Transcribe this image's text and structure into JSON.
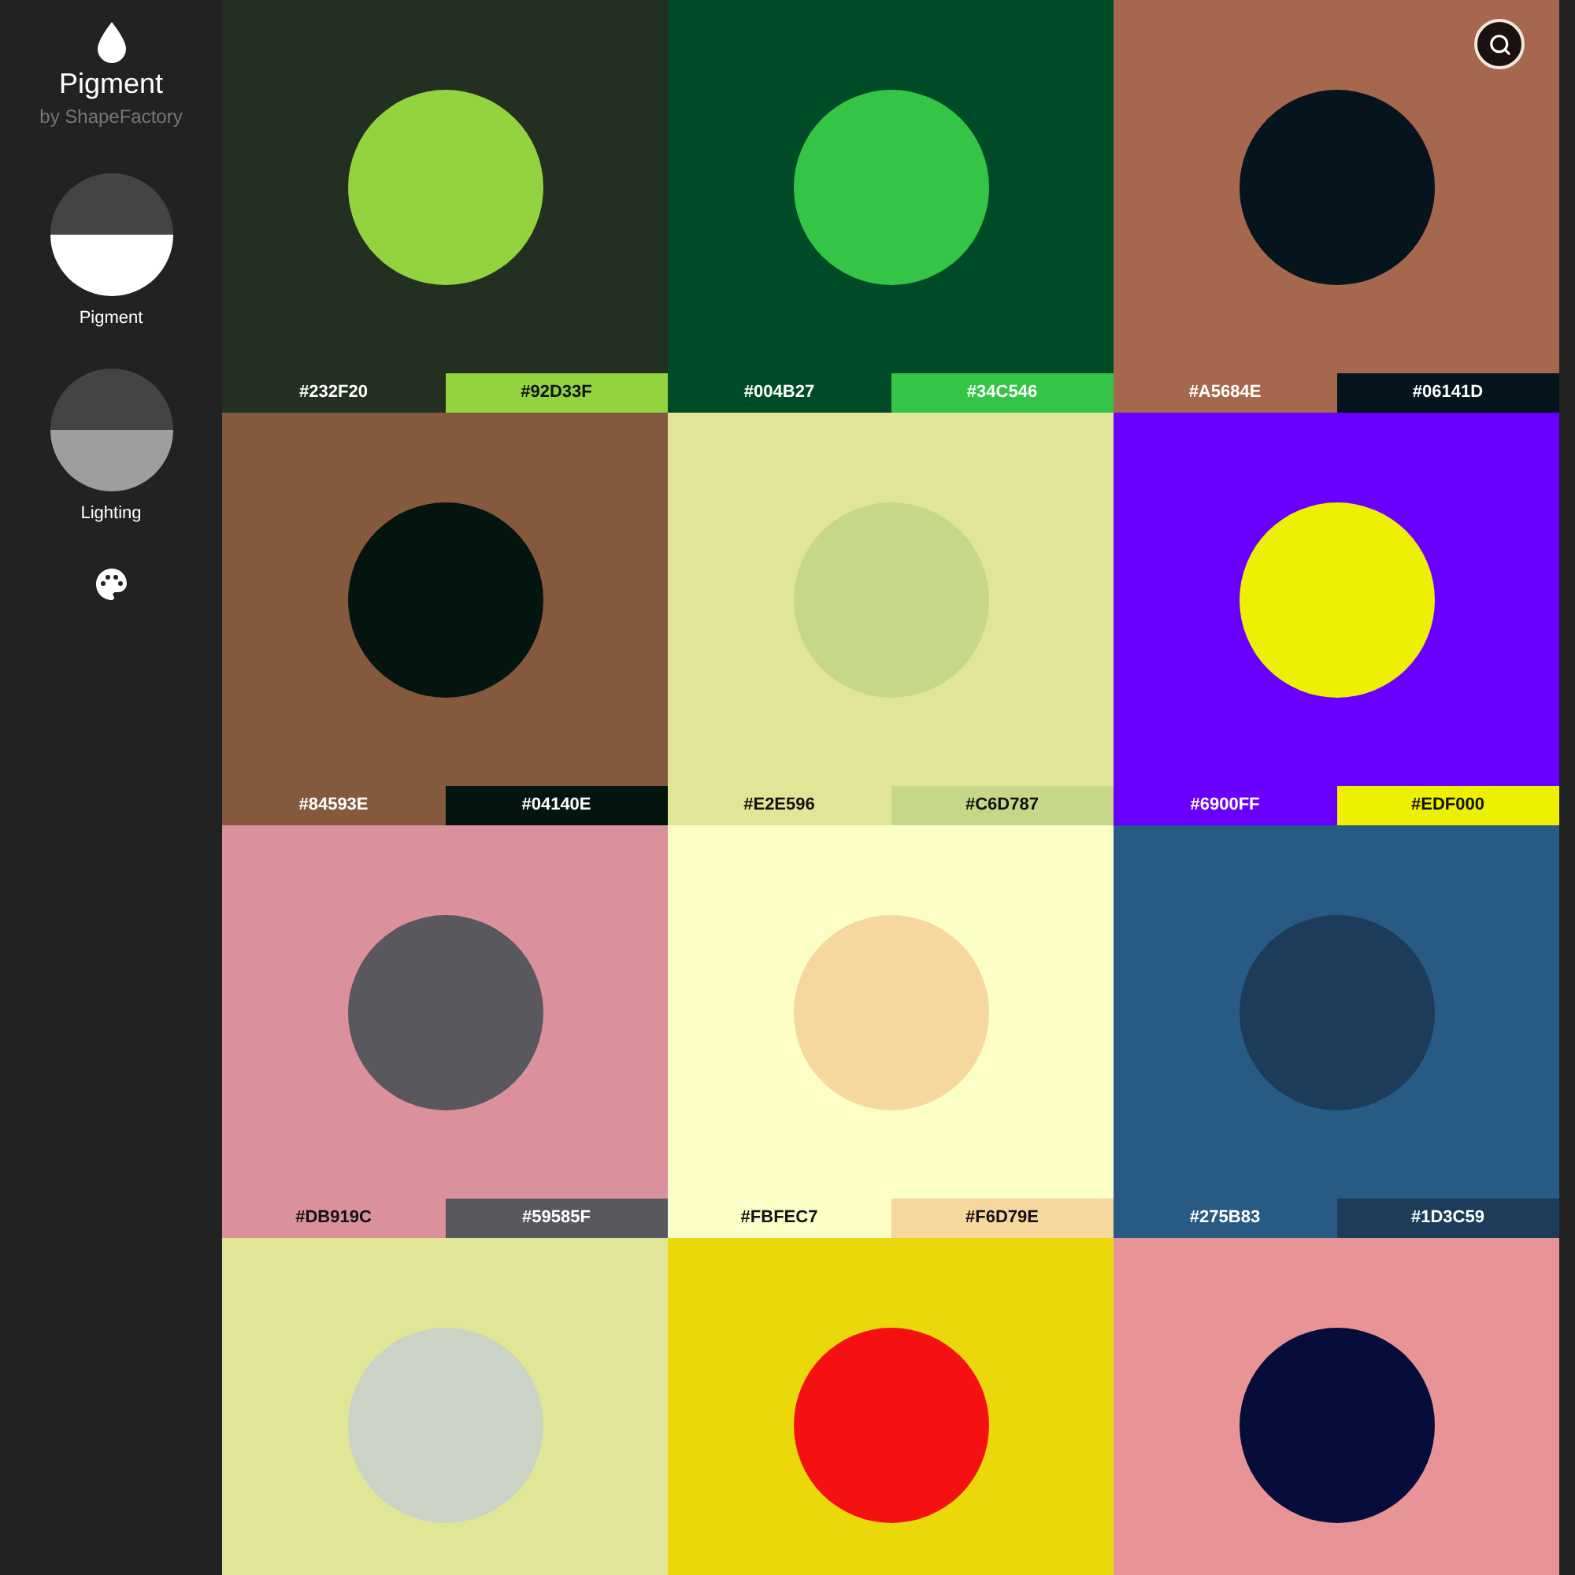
{
  "app": {
    "title": "Pigment",
    "subtitle": "by ShapeFactory"
  },
  "sidebar": {
    "items": [
      {
        "kind": "pigment",
        "label": "Pigment"
      },
      {
        "kind": "lighting",
        "label": "Lighting"
      },
      {
        "kind": "palette"
      }
    ]
  },
  "palettes": [
    {
      "background": {
        "color": "#232f20",
        "label": "#232F20"
      },
      "shape": {
        "color": "#92d33f",
        "label": "#92D33F"
      }
    },
    {
      "background": {
        "color": "#004b27",
        "label": "#004B27"
      },
      "shape": {
        "color": "#34c546",
        "label": "#34C546"
      }
    },
    {
      "background": {
        "color": "#a5684e",
        "label": "#A5684E"
      },
      "shape": {
        "color": "#06141d",
        "label": "#06141D"
      }
    },
    {
      "background": {
        "color": "#84593e",
        "label": "#84593E"
      },
      "shape": {
        "color": "#04140e",
        "label": "#04140E"
      }
    },
    {
      "background": {
        "color": "#e2e596",
        "label": "#E2E596"
      },
      "shape": {
        "color": "#c6d787",
        "label": "#C6D787"
      }
    },
    {
      "background": {
        "color": "#6900ff",
        "label": "#6900FF"
      },
      "shape": {
        "color": "#edf000",
        "label": "#EDF000"
      }
    },
    {
      "background": {
        "color": "#db919c",
        "label": "#DB919C"
      },
      "shape": {
        "color": "#59585f",
        "label": "#59585F"
      }
    },
    {
      "background": {
        "color": "#fbfec7",
        "label": "#FBFEC7"
      },
      "shape": {
        "color": "#f6d79e",
        "label": "#F6D79E"
      }
    },
    {
      "background": {
        "color": "#275b83",
        "label": "#275B83"
      },
      "shape": {
        "color": "#1d3c59",
        "label": "#1D3C59"
      }
    },
    {
      "background": {
        "color": "#e1e596"
      },
      "shape": {
        "color": "#cbd2c6"
      }
    },
    {
      "background": {
        "color": "#ebd80b"
      },
      "shape": {
        "color": "#f51111"
      }
    },
    {
      "background": {
        "color": "#e89496"
      },
      "shape": {
        "color": "#060d3a"
      }
    }
  ]
}
